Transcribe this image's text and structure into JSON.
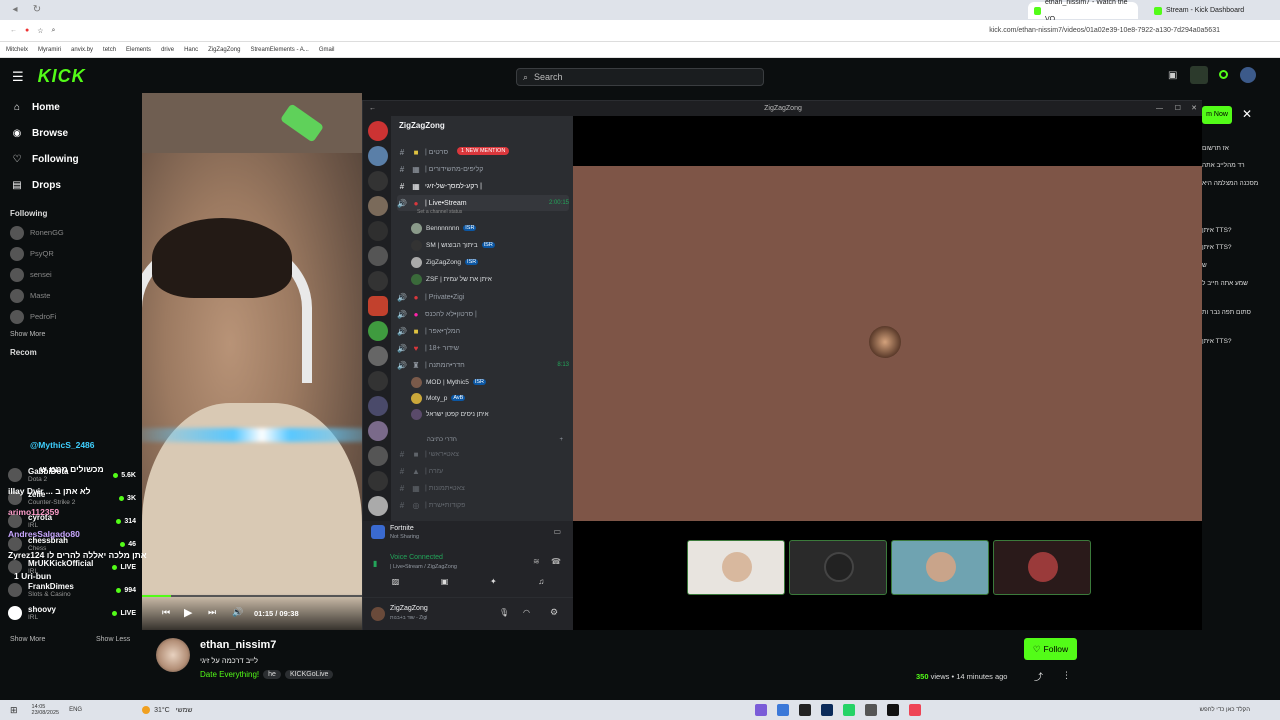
{
  "browser": {
    "tabs": [
      {
        "title": "ethan_nissim7 - Watch the VO..."
      },
      {
        "title": "Stream - Kick Dashboard"
      }
    ],
    "url": "kick.com/ethan-nissim7/videos/01a02e39-10e8-7922-a130-7d294a0a5631",
    "bookmarks": [
      "Mitchelx",
      "Myramiri",
      "anvix.by",
      "tetch",
      "Elements",
      "drive",
      "Hanc",
      "ZigZagZong",
      "StreamElements - A...",
      "Gmail"
    ]
  },
  "header": {
    "logo": "KICK",
    "search_placeholder": "Search"
  },
  "sidebar": {
    "nav": [
      {
        "label": "Home",
        "icon": "home-icon"
      },
      {
        "label": "Browse",
        "icon": "compass-icon"
      },
      {
        "label": "Following",
        "icon": "heart-icon"
      },
      {
        "label": "Drops",
        "icon": "drops-icon"
      }
    ],
    "following_title": "Following",
    "following": [
      "RonenGG",
      "PsyQR",
      "sensei",
      "Maste",
      "PedroFi"
    ],
    "show_more": "Show More",
    "recommended_title": "Recom",
    "channels": [
      {
        "name": "GabbiDota",
        "game": "Dota 2",
        "viewers": "5.6K"
      },
      {
        "name": "zelie",
        "game": "Counter-Strike 2",
        "viewers": "3K"
      },
      {
        "name": "cyrota",
        "game": "IRL",
        "viewers": "314"
      },
      {
        "name": "chessbrah",
        "game": "Chess",
        "viewers": "46"
      },
      {
        "name": "MrUKKickOfficial",
        "game": "IRL",
        "viewers": "LIVE"
      },
      {
        "name": "FrankDimes",
        "game": "Slots & Casino",
        "viewers": "994"
      },
      {
        "name": "shoovy",
        "game": "IRL",
        "viewers": "LIVE"
      }
    ],
    "show_more_bottom": "Show More",
    "show_less": "Show Less"
  },
  "overlay_chat": [
    {
      "text": "@MythicS_2486",
      "color": "#3fd0ff"
    },
    {
      "text": "מכשולים ממנו ש",
      "color": "#ffffff"
    },
    {
      "text": "iIIay Dvir ... לא אתן ב",
      "color": "#ffffff"
    },
    {
      "text": "arimo112359",
      "color": "#ff9ecb"
    },
    {
      "text": "AndresSalgado80",
      "color": "#c9a7ff"
    },
    {
      "text": "Zyrez124 אתן מלכה יאללה להרים לו",
      "color": "#ffffff"
    },
    {
      "text": "1 Uri-bun",
      "color": "#ffffff"
    }
  ],
  "video": {
    "time": "01:15 / 09:38",
    "progress": 0.13
  },
  "discord": {
    "window_title": "ZigZagZong",
    "server_name": "ZigZagZong",
    "new_mention": "1 NEW MENTION",
    "channels": [
      {
        "name": "| סרטים",
        "type": "text"
      },
      {
        "name": "| קליפים-מהשידורים",
        "type": "text"
      },
      {
        "name": "רקע-למסך-של-זיגי |",
        "type": "text"
      },
      {
        "name": "| Live•Stream",
        "type": "voice-live",
        "time": "2:00:15",
        "status": "Set a channel status"
      },
      {
        "name": "| Private•Zigi",
        "type": "voice"
      },
      {
        "name": "סרטון•לא להכנס |",
        "type": "voice"
      },
      {
        "name": "| המלך•אפר",
        "type": "voice"
      },
      {
        "name": "| 18+ שידור",
        "type": "voice"
      },
      {
        "name": "| חדר•המתנה",
        "type": "voice-live",
        "time": "8:13"
      },
      {
        "name": "חדרי כתיבה",
        "type": "category"
      },
      {
        "name": "| צאט•ראשי",
        "type": "text"
      },
      {
        "name": "| עזרה",
        "type": "text"
      },
      {
        "name": "| צאט•תמונות",
        "type": "text"
      },
      {
        "name": "| פקודות•שרת",
        "type": "text"
      }
    ],
    "live_users": [
      {
        "name": "Bennnnnnn",
        "badge": "ISR"
      },
      {
        "name": "SM | ביתוך הבוצוש",
        "badge": "ISR"
      },
      {
        "name": "ZigZagZong",
        "badge": "ISR"
      },
      {
        "name": "ZSF | איתן את של עמית",
        "badge": ""
      }
    ],
    "waiting_users": [
      {
        "name": "MOD | Mythic5",
        "badge": "ISR"
      },
      {
        "name": "Moty_p",
        "badge": "AvB"
      },
      {
        "name": "איתן ניסים קפטן ישראל",
        "badge": ""
      }
    ],
    "activity": {
      "title": "Fortnite",
      "subtitle": "Not Sharing"
    },
    "voice": {
      "status": "Voice Connected",
      "detail": "| Live•Stream / ZigZagZong"
    },
    "user": {
      "name": "ZigZagZong",
      "sub": "שוד ב+בנות - Zigi"
    }
  },
  "channel": {
    "name": "ethan_nissim7",
    "title": "לייב דרכמה על זיגי",
    "category": "Date Everything!",
    "tags": [
      "he",
      "KICKGoLive"
    ],
    "views": "350",
    "views_label": "views",
    "ago": "14 minutes ago",
    "follow_label": "Follow"
  },
  "right_chat": {
    "button": "m Now",
    "lines": [
      "אז תרשום",
      "רד מהלייב אתה",
      "מסכנה המצלמה היא",
      "איתן TTS?",
      "איתן TTS?",
      "ש",
      "שמע אתה חייב ל",
      "סתום תפה נבר ות",
      "איתן TTS?"
    ]
  },
  "taskbar": {
    "weather": "31°C",
    "weather_label": "שמשי",
    "time": "14:05",
    "date": "23/08/2025",
    "lang": "ENG",
    "search_hint": "הקלד כאן כדי לחפש"
  },
  "colors": {
    "accent": "#53fc18",
    "discord_bg": "#2b2d31",
    "stage": "#7e5547"
  }
}
